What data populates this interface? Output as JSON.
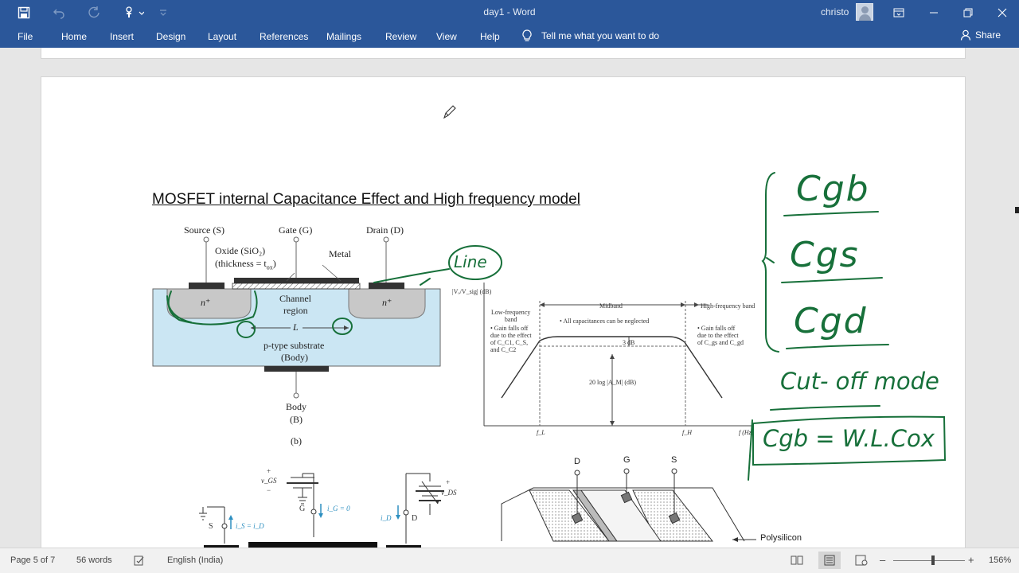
{
  "window": {
    "document_title": "day1  -  Word",
    "user_name": "christo"
  },
  "ribbon": {
    "tabs": [
      "File",
      "Home",
      "Insert",
      "Design",
      "Layout",
      "References",
      "Mailings",
      "Review",
      "View",
      "Help"
    ],
    "tell_me": "Tell me what you want to do",
    "share": "Share"
  },
  "document": {
    "heading": "MOSFET internal Capacitance Effect and High frequency model"
  },
  "figure_mosfet": {
    "source": "Source (S)",
    "gate": "Gate (G)",
    "drain": "Drain (D)",
    "oxide": "Oxide (SiO₂)",
    "thickness": "(thickness = t",
    "thickness_sub": "ox",
    "metal": "Metal",
    "n_plus": "n⁺",
    "channel": "Channel",
    "region": "region",
    "length": "L",
    "substrate": "p-type substrate",
    "body_paren": "(Body)",
    "body": "Body",
    "body_b": "(B)",
    "caption": "(b)"
  },
  "figure_freq": {
    "y_label": "|Vₒ/V_sig| (dB)",
    "low_band": "Low-frequency\nband",
    "midband": "Midband",
    "high_band": "High-frequency band",
    "note_all": "• All capacitances can be neglected",
    "note_low": "• Gain falls off\ndue to the effect\nof C_C1, C_S,\nand C_C2",
    "note_high": "• Gain falls off\ndue to the effect\nof C_gs and C_gd",
    "three_db": "3 dB",
    "gain": "20 log |A_M| (dB)",
    "fl": "f_L",
    "fh": "f_H",
    "f_axis": "f (Hz)"
  },
  "figure_bias": {
    "vgs": "v_GS",
    "ig": "i_G = 0",
    "is": "i_S = i_D",
    "id": "i_D",
    "vds": "v_DS",
    "s": "S",
    "g": "G",
    "d": "D",
    "plus": "+",
    "minus": "−"
  },
  "figure_3d": {
    "d": "D",
    "g": "G",
    "s": "S",
    "poly": "Polysilicon"
  },
  "handwriting": {
    "cgb": "Cgb",
    "cgs": "Cgs",
    "cgd": "Cgd",
    "cutoff": "Cut- off mode",
    "formula": "Cgb = W.L.Cox",
    "circled": "Line"
  },
  "statusbar": {
    "page": "Page 5 of 7",
    "words": "56 words",
    "language": "English (India)",
    "zoom": "156%",
    "zoom_minus": "–",
    "zoom_plus": "+"
  },
  "colors": {
    "word_blue": "#2b579a",
    "ink_green": "#17703a"
  }
}
